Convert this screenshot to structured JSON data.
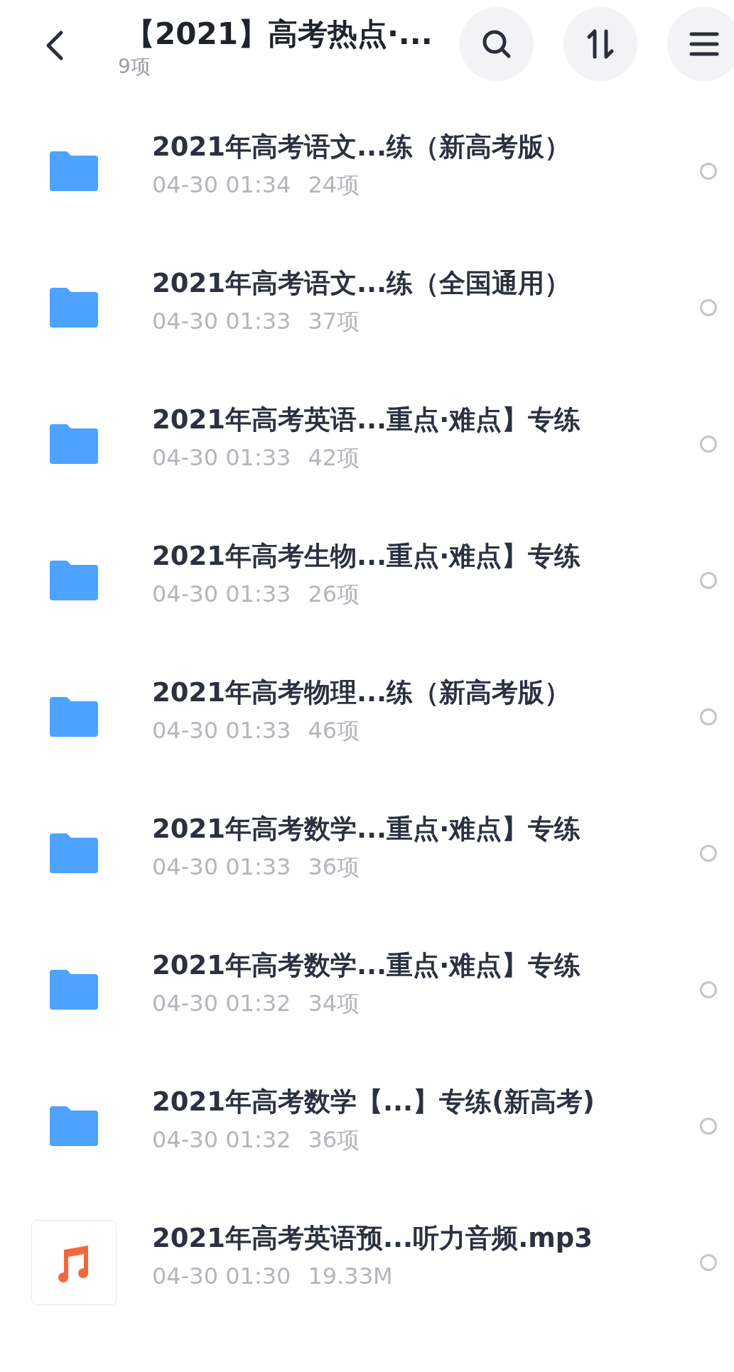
{
  "header": {
    "title": "【2021】高考热点·...",
    "count": "9项"
  },
  "files": [
    {
      "kind": "folder",
      "name": "2021年高考语文...练（新高考版）",
      "time": "04-30 01:34",
      "size": "24项",
      "selected": false
    },
    {
      "kind": "folder",
      "name": "2021年高考语文...练（全国通用）",
      "time": "04-30 01:33",
      "size": "37项",
      "selected": false
    },
    {
      "kind": "folder",
      "name": "2021年高考英语...重点·难点】专练",
      "time": "04-30 01:33",
      "size": "42项",
      "selected": false
    },
    {
      "kind": "folder",
      "name": "2021年高考生物...重点·难点】专练",
      "time": "04-30 01:33",
      "size": "26项",
      "selected": false
    },
    {
      "kind": "folder",
      "name": "2021年高考物理...练（新高考版）",
      "time": "04-30 01:33",
      "size": "46项",
      "selected": false
    },
    {
      "kind": "folder",
      "name": "2021年高考数学...重点·难点】专练",
      "time": "04-30 01:33",
      "size": "36项",
      "selected": false
    },
    {
      "kind": "folder",
      "name": "2021年高考数学...重点·难点】专练",
      "time": "04-30 01:32",
      "size": "34项",
      "selected": false
    },
    {
      "kind": "folder",
      "name": "2021年高考数学【...】专练(新高考)",
      "time": "04-30 01:32",
      "size": "36项",
      "selected": false
    },
    {
      "kind": "audio",
      "name": "2021年高考英语预...听力音频.mp3",
      "time": "04-30 01:30",
      "size": "19.33M",
      "selected": false
    }
  ]
}
